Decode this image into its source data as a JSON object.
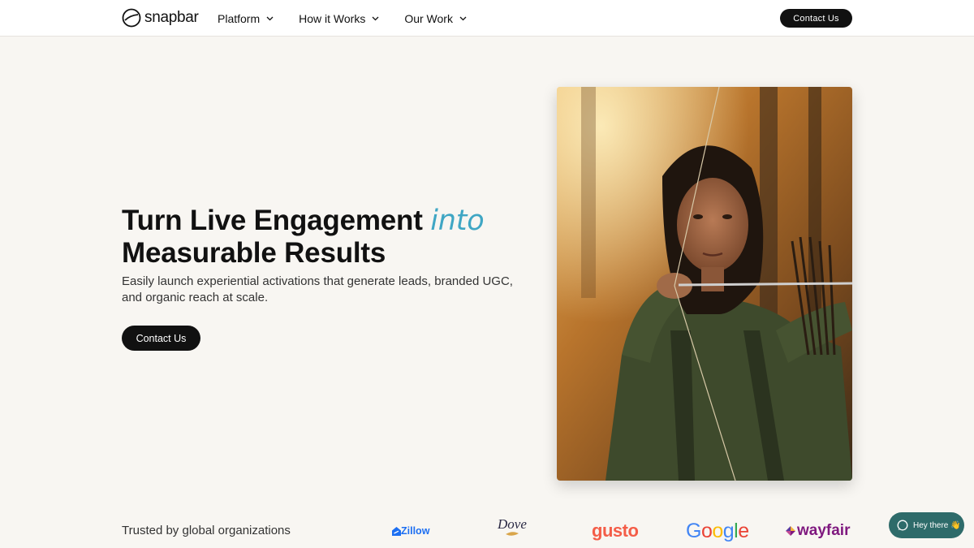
{
  "header": {
    "brand": "snapbar",
    "nav": [
      {
        "label": "Platform"
      },
      {
        "label": "How it Works"
      },
      {
        "label": "Our Work"
      }
    ],
    "cta": "Contact Us"
  },
  "hero": {
    "title_part1": "Turn Live Engagement ",
    "title_accent": "into",
    "title_part2": "Measurable Results",
    "subtitle": "Easily launch experiential activations that generate leads, branded UGC, and organic reach at scale.",
    "cta": "Contact Us",
    "accent_color": "#3fa6c4"
  },
  "trusted": {
    "label": "Trusted by global organizations",
    "brands": {
      "zillow": "Zillow",
      "dove": "Dove",
      "gusto": "gusto",
      "google": [
        "G",
        "o",
        "o",
        "g",
        "l",
        "e"
      ],
      "wayfair": "wayfair"
    }
  },
  "chat": {
    "label": "Hey there 👋"
  },
  "colors": {
    "background": "#f8f6f2",
    "button": "#111111",
    "chat": "#2e6b6a"
  }
}
